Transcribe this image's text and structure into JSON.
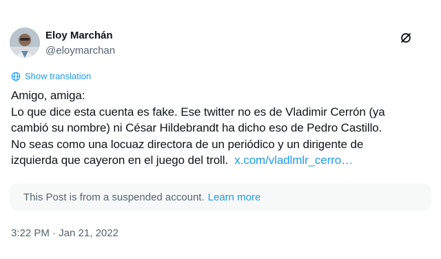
{
  "author": {
    "display_name": "Eloy Marchán",
    "handle": "@eloymarchan",
    "avatar_icon": "user-avatar"
  },
  "header": {
    "logo_icon": "x-logo-icon"
  },
  "translation": {
    "icon": "globe-icon",
    "label": "Show translation"
  },
  "post": {
    "text": "Amigo, amiga:\nLo que dice esta cuenta es fake. Ese twitter no es de Vladimir Cerrón (ya\ncambió su nombre) ni César Hildebrandt ha dicho eso de Pedro Castillo.\nNo seas como una locuaz directora de un periódico y un dirigente de\nizquierda que cayeron en el juego del troll.  ",
    "link_text": "x.com/vladlmlr_cerro…"
  },
  "notice": {
    "text": "This Post is from a suspended account.",
    "learn_more": "Learn more"
  },
  "meta": {
    "timestamp": "3:22 PM · Jan 21, 2022"
  },
  "colors": {
    "accent": "#1d9bf0",
    "text_primary": "#0f1419",
    "text_secondary": "#536471",
    "notice_bg": "#f7f9f9"
  }
}
